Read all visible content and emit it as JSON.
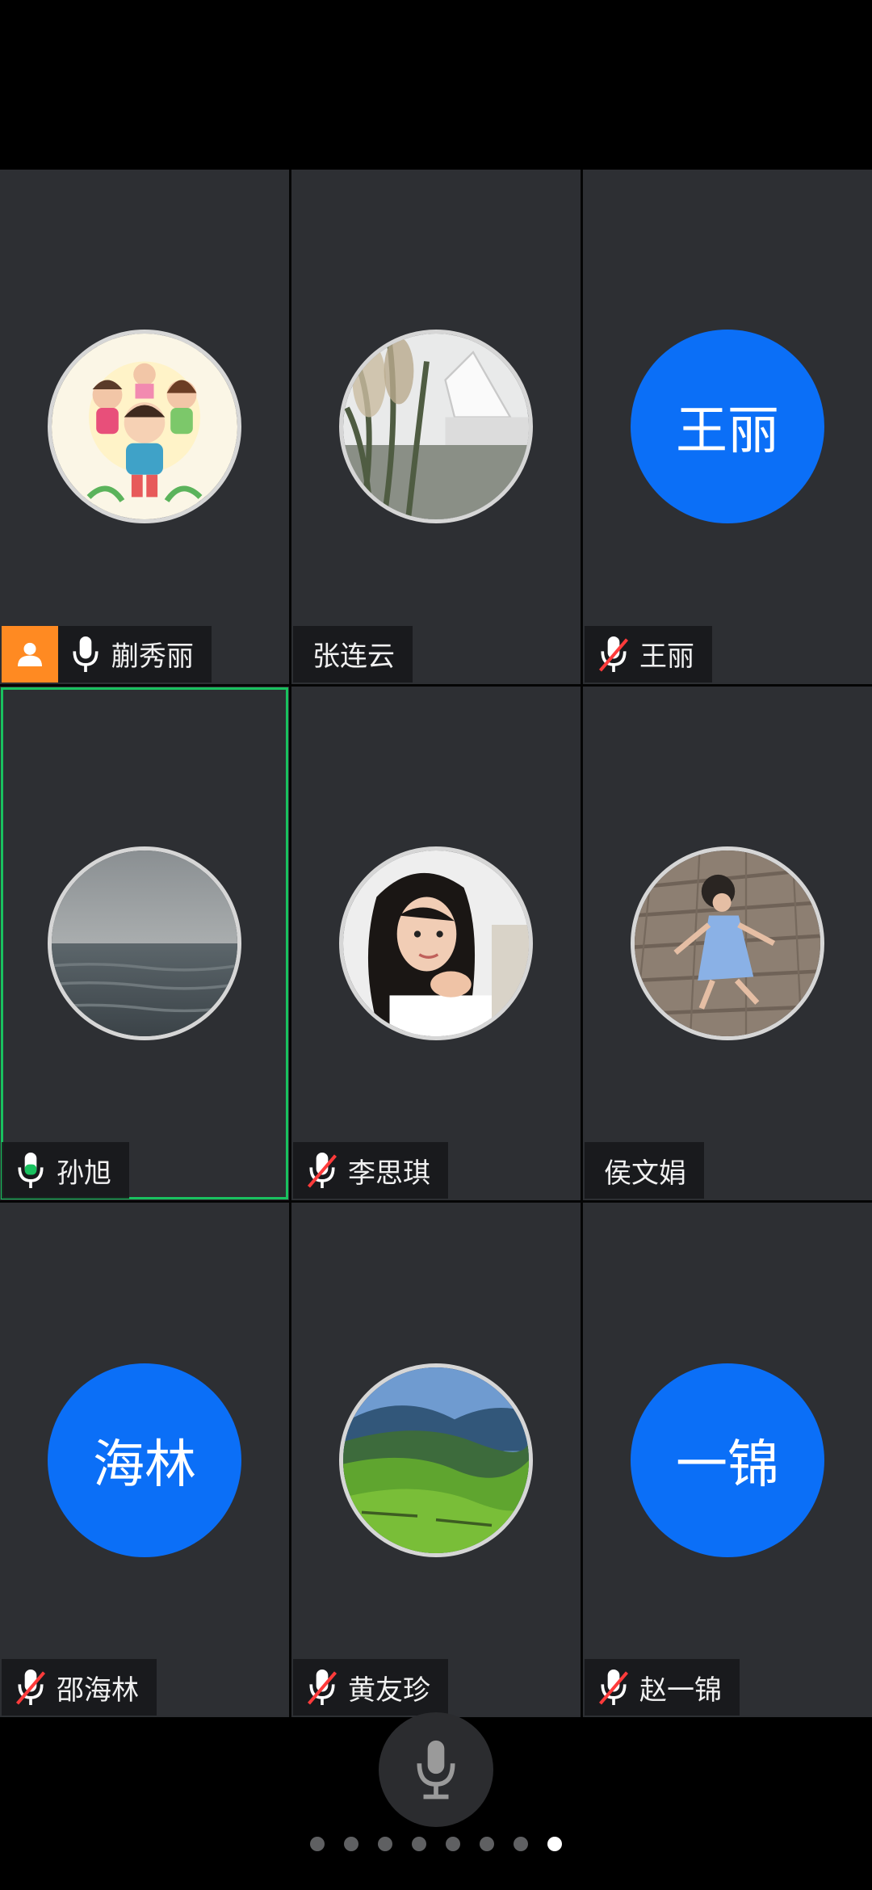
{
  "participants": [
    {
      "name": "蒯秀丽",
      "mic": "on",
      "host": true,
      "avatar": "photo-cartoon-family",
      "initials": ""
    },
    {
      "name": "张连云",
      "mic": "none",
      "host": false,
      "avatar": "photo-pampas-grass",
      "initials": ""
    },
    {
      "name": "王丽",
      "mic": "muted",
      "host": false,
      "avatar": "initials",
      "initials": "王丽"
    },
    {
      "name": "孙旭",
      "mic": "on",
      "host": false,
      "avatar": "photo-sea",
      "initials": "",
      "active_speaker": true
    },
    {
      "name": "李思琪",
      "mic": "muted",
      "host": false,
      "avatar": "photo-woman-portrait",
      "initials": ""
    },
    {
      "name": "侯文娟",
      "mic": "none",
      "host": false,
      "avatar": "photo-child-boardwalk",
      "initials": ""
    },
    {
      "name": "邵海林",
      "mic": "muted",
      "host": false,
      "avatar": "initials",
      "initials": "海林"
    },
    {
      "name": "黄友珍",
      "mic": "muted",
      "host": false,
      "avatar": "photo-green-hills",
      "initials": ""
    },
    {
      "name": "赵一锦",
      "mic": "muted",
      "host": false,
      "avatar": "initials",
      "initials": "一锦"
    }
  ],
  "colors": {
    "tile_bg": "#2d2f33",
    "initials_bg": "#0b6ff7",
    "host_badge": "#ff8a22",
    "active_outline": "#19c15f",
    "mute_slash": "#ff3b3b"
  },
  "pager": {
    "total": 8,
    "current": 8
  },
  "controls": {
    "mic_button": "microphone-icon"
  }
}
